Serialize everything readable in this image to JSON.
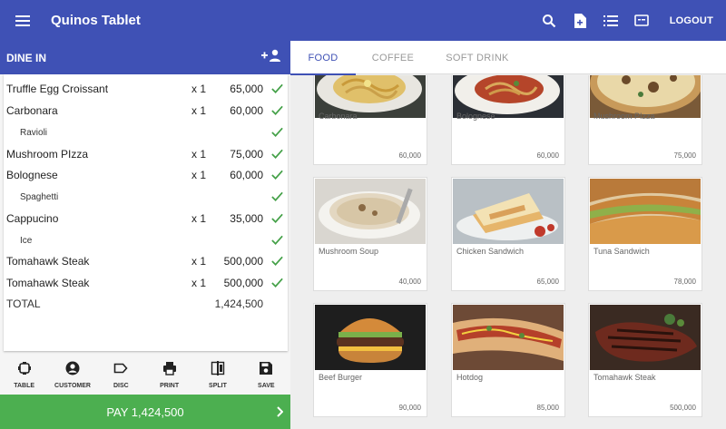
{
  "app": {
    "title": "Quinos Tablet",
    "logout_label": "LOGOUT"
  },
  "header": {
    "mode_label": "DINE IN"
  },
  "order": {
    "items": [
      {
        "name": "Truffle Egg Croissant",
        "qty": "x 1",
        "price": "65,000",
        "sub": false
      },
      {
        "name": "Carbonara",
        "qty": "x 1",
        "price": "60,000",
        "sub": false
      },
      {
        "name": "Ravioli",
        "qty": "",
        "price": "",
        "sub": true
      },
      {
        "name": "Mushroom PIzza",
        "qty": "x 1",
        "price": "75,000",
        "sub": false
      },
      {
        "name": "Bolognese",
        "qty": "x 1",
        "price": "60,000",
        "sub": false
      },
      {
        "name": "Spaghetti",
        "qty": "",
        "price": "",
        "sub": true
      },
      {
        "name": "Cappucino",
        "qty": "x 1",
        "price": "35,000",
        "sub": false
      },
      {
        "name": "Ice",
        "qty": "",
        "price": "",
        "sub": true
      },
      {
        "name": "Tomahawk Steak",
        "qty": "x 1",
        "price": "500,000",
        "sub": false
      },
      {
        "name": "Tomahawk Steak",
        "qty": "x 1",
        "price": "500,000",
        "sub": false
      }
    ],
    "total_label": "TOTAL",
    "total_value": "1,424,500"
  },
  "toolbar": {
    "table": "TABLE",
    "customer": "CUSTOMER",
    "disc": "DISC",
    "print": "PRINT",
    "split": "SPLIT",
    "save": "SAVE"
  },
  "pay": {
    "label": "PAY 1,424,500"
  },
  "tabs": [
    {
      "label": "FOOD"
    },
    {
      "label": "COFFEE"
    },
    {
      "label": "SOFT DRINK"
    }
  ],
  "menu": [
    {
      "name": "Carbonara",
      "price": "60,000"
    },
    {
      "name": "Bolognese",
      "price": "60,000"
    },
    {
      "name": "Mushroom PIzza",
      "price": "75,000"
    },
    {
      "name": "Mushroom Soup",
      "price": "40,000"
    },
    {
      "name": "Chicken Sandwich",
      "price": "65,000"
    },
    {
      "name": "Tuna Sandwich",
      "price": "78,000"
    },
    {
      "name": "Beef Burger",
      "price": "90,000"
    },
    {
      "name": "Hotdog",
      "price": "85,000"
    },
    {
      "name": "Tomahawk Steak",
      "price": "500,000"
    }
  ],
  "colors": {
    "primary": "#3f51b5",
    "pay": "#4caf50",
    "check": "#43a047"
  },
  "icons": {
    "menu": "hamburger-icon",
    "search": "search-icon",
    "note": "note-add-icon",
    "list": "list-icon",
    "card": "keyboard-icon",
    "add_person": "add-person-icon",
    "check": "check-icon"
  }
}
